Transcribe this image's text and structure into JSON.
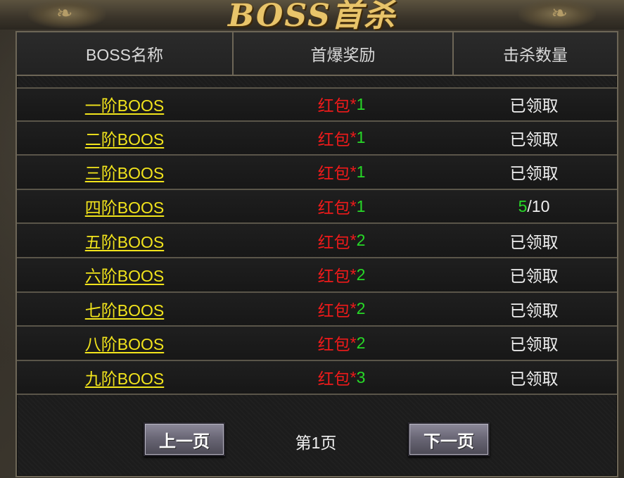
{
  "window": {
    "title": "BOSS首杀"
  },
  "table": {
    "headers": [
      "BOSS名称",
      "首爆奖励",
      "击杀数量"
    ],
    "rows": [
      {
        "name": "一阶BOOS",
        "reward": "红包",
        "star": "*",
        "count": "1",
        "status": "已领取"
      },
      {
        "name": "二阶BOOS",
        "reward": "红包",
        "star": "*",
        "count": "1",
        "status": "已领取"
      },
      {
        "name": "三阶BOOS",
        "reward": "红包",
        "star": "*",
        "count": "1",
        "status": "已领取"
      },
      {
        "name": "四阶BOOS",
        "reward": "红包",
        "star": "*",
        "count": "1",
        "progress_current": "5",
        "progress_total": "/10"
      },
      {
        "name": "五阶BOOS",
        "reward": "红包",
        "star": "*",
        "count": "2",
        "status": "已领取"
      },
      {
        "name": "六阶BOOS",
        "reward": "红包",
        "star": "*",
        "count": "2",
        "status": "已领取"
      },
      {
        "name": "七阶BOOS",
        "reward": "红包",
        "star": "*",
        "count": "2",
        "status": "已领取"
      },
      {
        "name": "八阶BOOS",
        "reward": "红包",
        "star": "*",
        "count": "2",
        "status": "已领取"
      },
      {
        "name": "九阶BOOS",
        "reward": "红包",
        "star": "*",
        "count": "3",
        "status": "已领取"
      }
    ]
  },
  "pager": {
    "prev_label": "上一页",
    "page_label": "第1页",
    "next_label": "下一页"
  },
  "colors": {
    "boss_link": "#f2e41c",
    "reward_red": "#f01a1a",
    "count_green": "#27d827",
    "status_white": "#f0f0f0",
    "title_gold": "#e8c46a"
  },
  "icons": {
    "left_ornament": "dragon-ornament-icon",
    "right_ornament": "dragon-ornament-icon"
  }
}
